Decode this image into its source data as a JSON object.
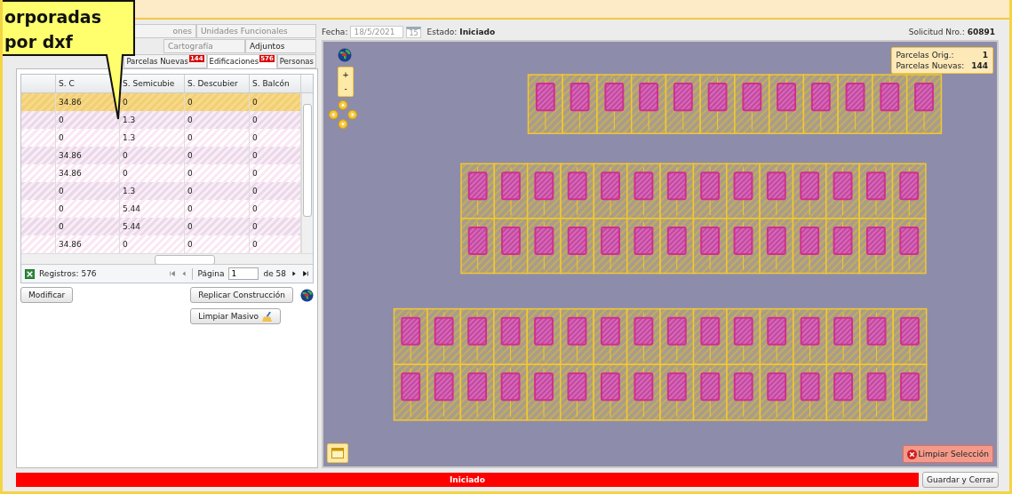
{
  "callout": {
    "lines": [
      "orporadas",
      "por dxf"
    ]
  },
  "tabs": [
    [
      {
        "label": "ones",
        "selected": false
      },
      {
        "label": "Unidades Funcionales",
        "selected": false
      }
    ],
    [
      {
        "label": "Cartografía",
        "selected": false
      },
      {
        "label": "Adjuntos",
        "selected": false
      }
    ],
    [
      {
        "label": "Parcelas Nuevas",
        "selected": false,
        "badge": "144"
      },
      {
        "label": "Edificaciones",
        "selected": true,
        "badge": "576"
      },
      {
        "label": "Personas",
        "selected": false
      }
    ]
  ],
  "table": {
    "columns": [
      "S. C",
      "S. Semicubie",
      "S. Descubier",
      "S. Balcón"
    ],
    "rows": [
      {
        "selected": true,
        "cells": [
          "34.86",
          "0",
          "0",
          "0"
        ]
      },
      {
        "selected": false,
        "cells": [
          "0",
          "1.3",
          "0",
          "0"
        ]
      },
      {
        "selected": false,
        "cells": [
          "0",
          "1.3",
          "0",
          "0"
        ]
      },
      {
        "selected": false,
        "cells": [
          "34.86",
          "0",
          "0",
          "0"
        ]
      },
      {
        "selected": false,
        "cells": [
          "34.86",
          "0",
          "0",
          "0"
        ]
      },
      {
        "selected": false,
        "cells": [
          "0",
          "1.3",
          "0",
          "0"
        ]
      },
      {
        "selected": false,
        "cells": [
          "0",
          "5.44",
          "0",
          "0"
        ]
      },
      {
        "selected": false,
        "cells": [
          "0",
          "5.44",
          "0",
          "0"
        ]
      },
      {
        "selected": false,
        "cells": [
          "34.86",
          "0",
          "0",
          "0"
        ]
      }
    ]
  },
  "pager": {
    "records": "Registros: 576",
    "page_label": "Página",
    "page": "1",
    "of": "de 58"
  },
  "buttons": {
    "modify": "Modificar",
    "replicate": "Replicar Construcción",
    "clear_bulk": "Limpiar Masivo"
  },
  "header": {
    "date_label": "Fecha:",
    "date": "18/5/2021",
    "calendar": "15",
    "status_label": "Estado:",
    "status": "Iniciado",
    "request_label": "Solicitud Nro.:",
    "request": "60891"
  },
  "map": {
    "info": [
      {
        "label": "Parcelas Orig.:",
        "value": "1"
      },
      {
        "label": "Parcelas Nuevas:",
        "value": "144"
      }
    ],
    "zoom_in": "+",
    "zoom_out": "-",
    "clear_button": "Limpiar Selección"
  },
  "status_bar": {
    "text": "Iniciado"
  },
  "save_button": "Guardar y Cerrar"
}
